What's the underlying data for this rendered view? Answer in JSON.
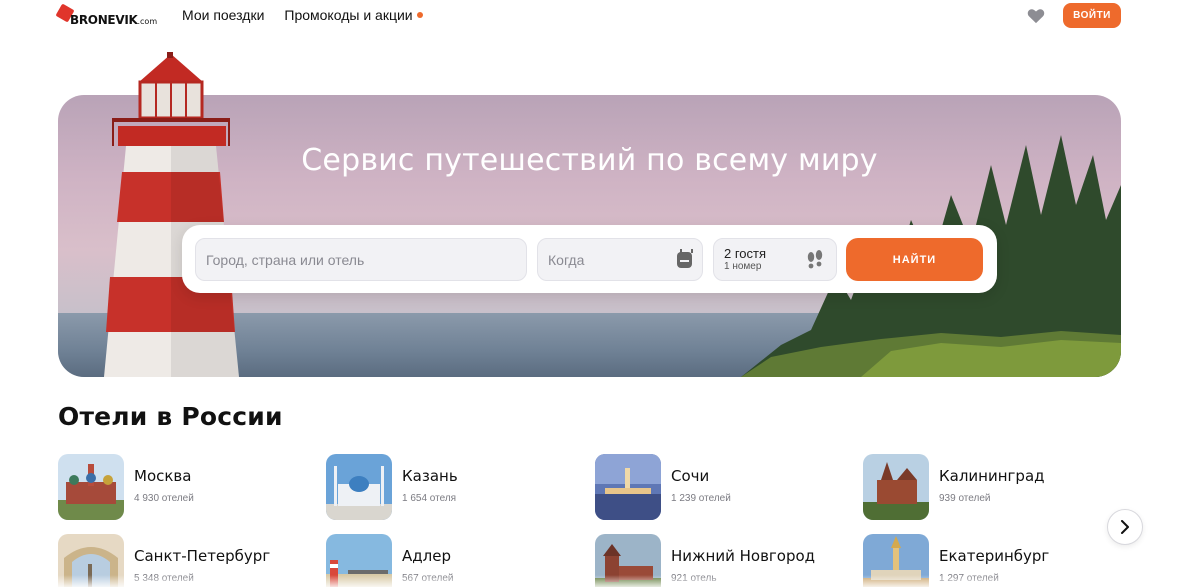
{
  "header": {
    "logo_text": "BRONEVIK",
    "logo_suffix": ".com",
    "nav": [
      {
        "label": "Мои поездки"
      },
      {
        "label": "Промокоды и акции"
      }
    ],
    "login_label": "ВОЙТИ",
    "accent_color": "#ee6a2c"
  },
  "hero": {
    "title": "Сервис путешествий по всему миру",
    "search": {
      "city_placeholder": "Город, страна или отель",
      "date_placeholder": "Когда",
      "guests": "2 гостя",
      "rooms": "1 номер",
      "submit_label": "НАЙТИ"
    }
  },
  "hotels": {
    "title": "Отели в России",
    "cities": [
      {
        "name": "Москва",
        "count": "4 930 отелей"
      },
      {
        "name": "Казань",
        "count": "1 654 отеля"
      },
      {
        "name": "Сочи",
        "count": "1 239 отелей"
      },
      {
        "name": "Калининград",
        "count": "939 отелей"
      },
      {
        "name": "Санкт-Петербург",
        "count": "5 348 отелей"
      },
      {
        "name": "Адлер",
        "count": "567 отелей"
      },
      {
        "name": "Нижний Новгород",
        "count": "921 отель"
      },
      {
        "name": "Екатеринбург",
        "count": "1 297 отелей"
      }
    ],
    "next_icon": "chevron-right-icon"
  }
}
